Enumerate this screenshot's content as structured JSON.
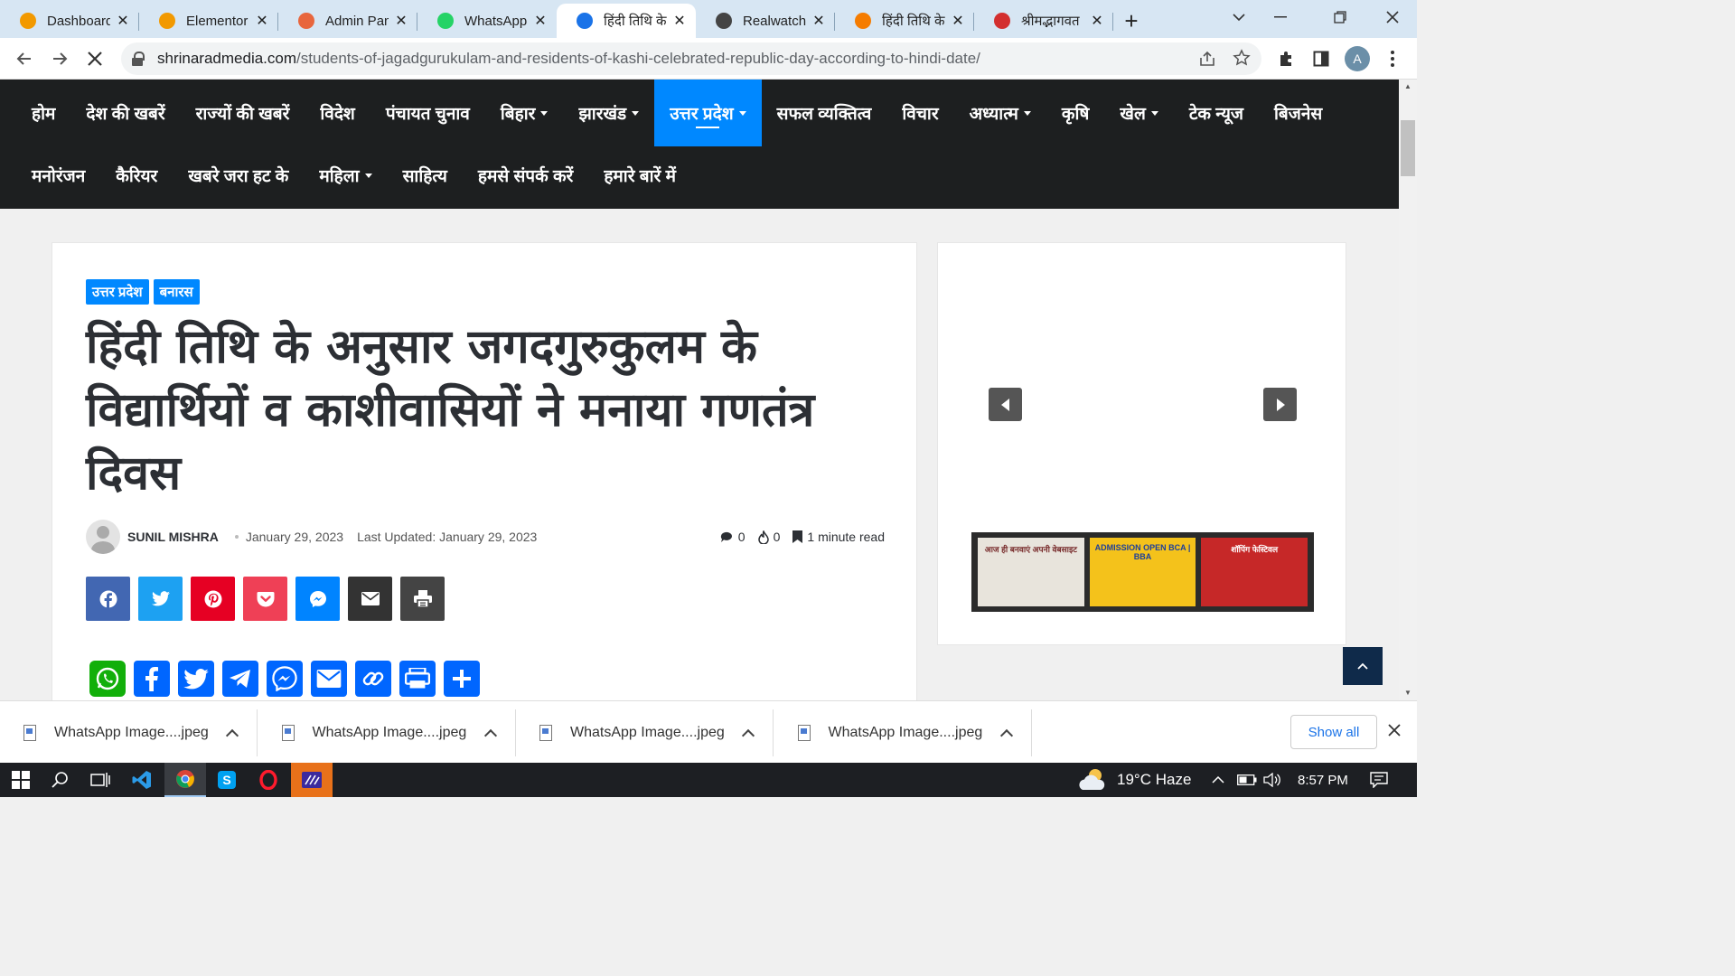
{
  "tabs": [
    {
      "title": "Dashboard",
      "favicon_color": "#f29900",
      "active": false
    },
    {
      "title": "Elementor |",
      "favicon_color": "#f29900",
      "active": false
    },
    {
      "title": "Admin Pane",
      "favicon_color": "#e8663d",
      "active": false
    },
    {
      "title": "WhatsApp",
      "favicon_color": "#25d366",
      "active": false
    },
    {
      "title": "हिंदी तिथि के",
      "favicon_color": "#1a73e8",
      "active": true
    },
    {
      "title": "Realwatchn",
      "favicon_color": "#444444",
      "active": false
    },
    {
      "title": "हिंदी तिथि के",
      "favicon_color": "#f57c00",
      "active": false
    },
    {
      "title": "श्रीमद्भागवत",
      "favicon_color": "#d32f2f",
      "active": false
    }
  ],
  "address_bar": {
    "host": "shrinaradmedia.com",
    "path": "/students-of-jagadgurukulam-and-residents-of-kashi-celebrated-republic-day-according-to-hindi-date/"
  },
  "profile_initial": "A",
  "nav": {
    "row1": [
      {
        "label": "होम",
        "dropdown": false,
        "active": false
      },
      {
        "label": "देश की खबरें",
        "dropdown": false,
        "active": false
      },
      {
        "label": "राज्यों की खबरें",
        "dropdown": false,
        "active": false
      },
      {
        "label": "विदेश",
        "dropdown": false,
        "active": false
      },
      {
        "label": "पंचायत चुनाव",
        "dropdown": false,
        "active": false
      },
      {
        "label": "बिहार",
        "dropdown": true,
        "active": false
      },
      {
        "label": "झारखंड",
        "dropdown": true,
        "active": false
      },
      {
        "label": "उत्तर प्रदेश",
        "dropdown": true,
        "active": true
      },
      {
        "label": "सफल व्यक्तित्व",
        "dropdown": false,
        "active": false
      },
      {
        "label": "विचार",
        "dropdown": false,
        "active": false
      },
      {
        "label": "अध्यात्म",
        "dropdown": true,
        "active": false
      },
      {
        "label": "कृषि",
        "dropdown": false,
        "active": false
      },
      {
        "label": "खेल",
        "dropdown": true,
        "active": false
      },
      {
        "label": "टेक न्यूज",
        "dropdown": false,
        "active": false
      },
      {
        "label": "बिजनेस",
        "dropdown": false,
        "active": false
      }
    ],
    "row2": [
      {
        "label": "मनोरंजन",
        "dropdown": false,
        "active": false
      },
      {
        "label": "कैरियर",
        "dropdown": false,
        "active": false
      },
      {
        "label": "खबरे जरा हट के",
        "dropdown": false,
        "active": false
      },
      {
        "label": "महिला",
        "dropdown": true,
        "active": false
      },
      {
        "label": "साहित्य",
        "dropdown": false,
        "active": false
      },
      {
        "label": "हमसे संपर्क करें",
        "dropdown": false,
        "active": false
      },
      {
        "label": "हमारे बारें में",
        "dropdown": false,
        "active": false
      }
    ]
  },
  "article": {
    "categories": [
      "उत्तर प्रदेश",
      "बनारस"
    ],
    "title": "हिंदी तिथि के अनुसार जगदगुरुकुलम के विद्यार्थियों व काशीवासियों ने मनाया गणतंत्र दिवस",
    "author": "SUNIL MISHRA",
    "date": "January 29, 2023",
    "last_updated": "Last Updated: January 29, 2023",
    "comments": "0",
    "views": "0",
    "read_time": "1 minute read"
  },
  "share_buttons": [
    {
      "name": "facebook",
      "color": "#4267b2"
    },
    {
      "name": "twitter",
      "color": "#1da1f2"
    },
    {
      "name": "pinterest",
      "color": "#e60023"
    },
    {
      "name": "pocket",
      "color": "#ef4056"
    },
    {
      "name": "messenger",
      "color": "#0084ff"
    },
    {
      "name": "email",
      "color": "#333333"
    },
    {
      "name": "print",
      "color": "#444444"
    }
  ],
  "addtoany_buttons": [
    "whatsapp",
    "facebook",
    "twitter",
    "telegram",
    "messenger",
    "email",
    "copy-link",
    "print",
    "share"
  ],
  "ads": [
    {
      "text": "आज ही बनवाएं अपनी वेबसाइट",
      "bg": "#e8e4dc"
    },
    {
      "text": "ADMISSION OPEN BCA | BBA",
      "bg": "#f4c21b"
    },
    {
      "text": "शॉपिंग फेस्टिवल",
      "bg": "#c62828"
    }
  ],
  "downloads": [
    {
      "name": "WhatsApp Image....jpeg"
    },
    {
      "name": "WhatsApp Image....jpeg"
    },
    {
      "name": "WhatsApp Image....jpeg"
    },
    {
      "name": "WhatsApp Image....jpeg"
    }
  ],
  "downloads_show_all": "Show all",
  "taskbar": {
    "weather": "19°C  Haze",
    "time": "8:57 PM"
  }
}
